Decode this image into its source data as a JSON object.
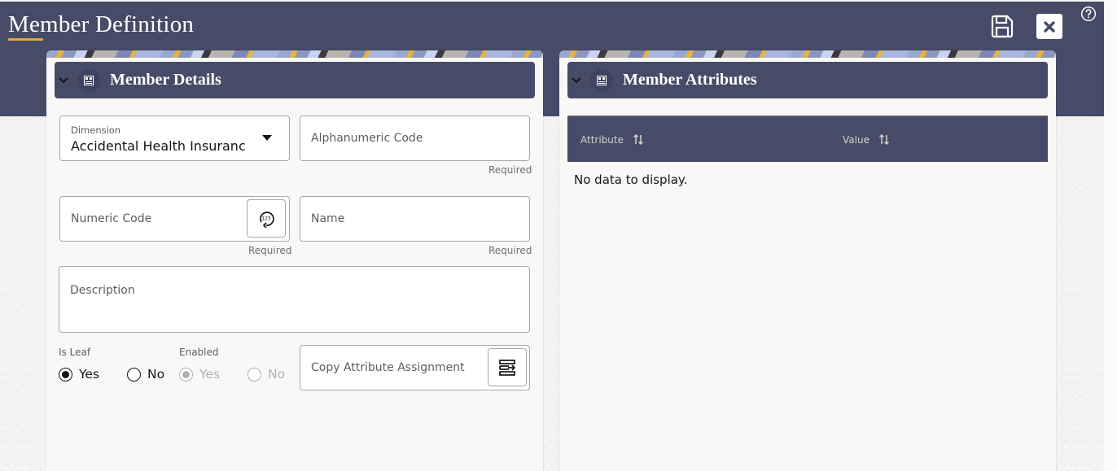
{
  "page": {
    "title": "Member Definition",
    "accent_color": "#e3a93d",
    "header_color": "#474b67"
  },
  "toolbar": {
    "save_icon": "save-floppy-icon",
    "close_icon": "close-x-icon",
    "help_icon": "help-question-icon"
  },
  "member_details": {
    "title": "Member Details",
    "collapse_icon": "chevron-down-icon",
    "section_icon": "panel-icon",
    "dimension": {
      "label": "Dimension",
      "value": "Accidental Health Insuranc"
    },
    "alphanumeric_code": {
      "placeholder": "Alphanumeric Code",
      "helper": "Required"
    },
    "numeric_code": {
      "placeholder": "Numeric Code",
      "helper": "Required",
      "button_icon": "generate-number-icon"
    },
    "name": {
      "placeholder": "Name",
      "helper": "Required"
    },
    "description": {
      "placeholder": "Description"
    },
    "is_leaf": {
      "label": "Is Leaf",
      "options": [
        {
          "label": "Yes",
          "selected": true,
          "disabled": false
        },
        {
          "label": "No",
          "selected": false,
          "disabled": false
        }
      ]
    },
    "enabled": {
      "label": "Enabled",
      "options": [
        {
          "label": "Yes",
          "selected": true,
          "disabled": true
        },
        {
          "label": "No",
          "selected": false,
          "disabled": true
        }
      ]
    },
    "copy_attribute": {
      "placeholder": "Copy Attribute Assignment",
      "button_icon": "copy-assignment-icon"
    }
  },
  "member_attributes": {
    "title": "Member Attributes",
    "collapse_icon": "chevron-down-icon",
    "section_icon": "panel-icon",
    "columns": [
      {
        "label": "Attribute",
        "sort_icon": "sort-icon"
      },
      {
        "label": "Value",
        "sort_icon": "sort-icon"
      }
    ],
    "rows": [],
    "empty_text": "No data to display."
  }
}
